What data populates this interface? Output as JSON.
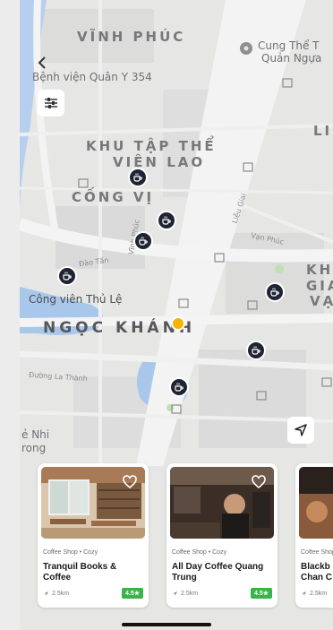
{
  "map": {
    "districts": {
      "vinh_phuc": "VĨNH PHÚC",
      "khu_tap_the_1": "KHU TẬP THỂ",
      "khu_tap_the_2": "VIỆN LAO",
      "cong_vi": "CỐNG VỊ",
      "ngoc_khanh": "NGỌC KHÁNH",
      "right_1": "KH",
      "right_2": "GIA",
      "right_3": "VẠ",
      "right_top": "LI"
    },
    "pois": {
      "hospital": "Bệnh viện Quân Y 354",
      "cung_the_1": "Cung Thể T",
      "cung_the_2": "Quản Ngựa",
      "park": "Công viên Thủ Lệ",
      "nhi_1": "ẻ Nhi",
      "nhi_2": "rong"
    },
    "streets": {
      "lieu_giai": "Liễu Giai",
      "dao_tan": "Đào Tấn",
      "van_phuc": "Vạn Phúc",
      "duong_la_thanh": "Đường La Thành",
      "vinh_phuc_st": "Vĩnh Phúc"
    },
    "colors": {
      "pin": "#1f2433",
      "user_location": "#f5b400",
      "water": "#a9c7ea",
      "park": "#cfe2c6"
    }
  },
  "controls": {
    "back_icon": "chevron-left-icon",
    "filter_icon": "sliders-icon",
    "locate_icon": "navigation-arrow-icon"
  },
  "cards": [
    {
      "category": "Coffee Shop • Cozy",
      "name": "Tranquil Books & Coffee",
      "distance": "2.5km",
      "rating": "4.5"
    },
    {
      "category": "Coffee Shop • Cozy",
      "name": "All Day Coffee Quang Trung",
      "distance": "2.5km",
      "rating": "4.5"
    },
    {
      "category": "Coffee Shop • Cozy",
      "name": "Blackb Chan C",
      "distance": "2.5km",
      "rating": "4.5"
    }
  ]
}
